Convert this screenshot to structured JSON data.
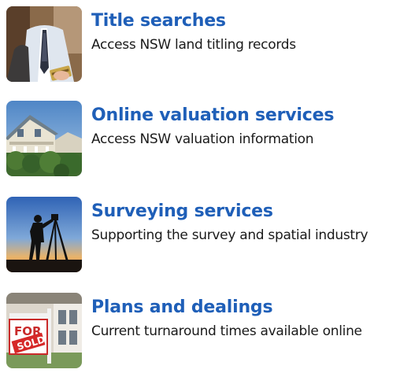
{
  "colors": {
    "link": "#1f5fb8",
    "text": "#1a1a1a",
    "background": "#ffffff"
  },
  "services": [
    {
      "title": "Title searches",
      "description": "Access NSW land titling records",
      "image": "businessman-with-card-photo"
    },
    {
      "title": "Online valuation services",
      "description": "Access NSW valuation information",
      "image": "house-photo"
    },
    {
      "title": "Surveying services",
      "description": "Supporting the survey and spatial industry",
      "image": "surveyor-silhouette-photo"
    },
    {
      "title": "Plans and dealings",
      "description": "Current turnaround times available online",
      "image": "for-sale-sign-photo",
      "sign_text": "FOR",
      "sign_overlay": "SOLD"
    }
  ]
}
